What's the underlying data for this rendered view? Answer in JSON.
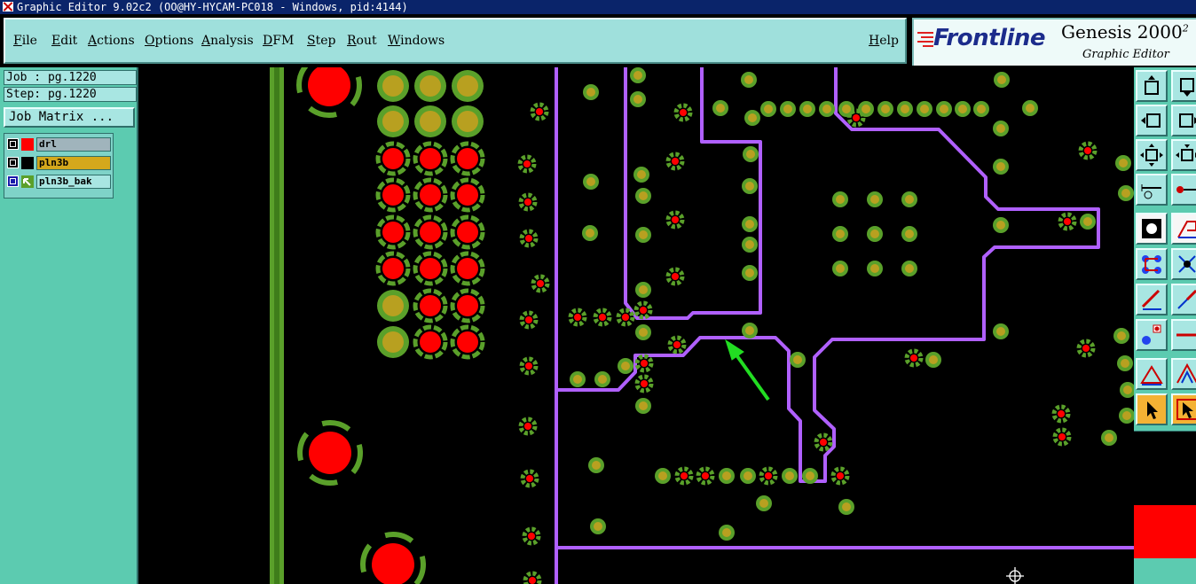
{
  "window": {
    "title": "Graphic Editor 9.02c2 (OO@HY-HYCAM-PC018 - Windows, pid:4144)"
  },
  "menu": {
    "items": [
      "File",
      "Edit",
      "Actions",
      "Options",
      "Analysis",
      "DFM",
      "Step",
      "Rout",
      "Windows"
    ],
    "help": "Help"
  },
  "brand": {
    "logo": "Frontline",
    "product": "Genesis 2000",
    "product_suffix": "2",
    "subtitle": "Graphic Editor"
  },
  "left_panel": {
    "job": "Job : pg.1220",
    "step": "Step: pg.1220",
    "job_matrix_button": "Job Matrix ...",
    "layers": [
      {
        "name": "drl",
        "color": "#ff0000",
        "name_bg": "#a0b4bc"
      },
      {
        "name": "pln3b",
        "color": "#000000",
        "name_bg": "#d4a81c"
      },
      {
        "name": "pln3b_bak",
        "color": "#5aa02a",
        "name_bg": "#a8e6e2"
      }
    ]
  },
  "colors": {
    "canvas_bg": "#000000",
    "pad_red": "#ff0000",
    "pad_olive": "#b8a020",
    "pad_green": "#5aa02a",
    "trace_purple": "#b060ff",
    "arrow_green": "#22dd22",
    "panel_teal": "#5ccbb0",
    "menu_bg": "#9fe0dc"
  },
  "right_toolbar": {
    "tools": [
      "move-up-icon",
      "move-up-alt-icon",
      "move-left-icon",
      "move-right-icon",
      "fit-icon",
      "fit-alt-icon",
      "ruler-icon",
      "probe-icon",
      "snapshot-icon",
      "flag-icon",
      "net-icon",
      "cross-icon",
      "line-red-icon",
      "line-blue-icon",
      "add-pad-icon",
      "line-horizontal-icon",
      "triangle-icon",
      "triangle-alt-icon",
      "pointer-icon",
      "pointer-alt-icon"
    ]
  }
}
